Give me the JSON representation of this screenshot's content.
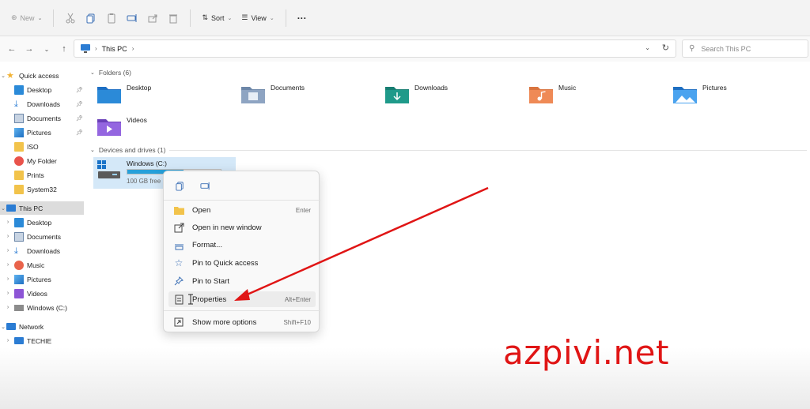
{
  "toolbar": {
    "new_label": "New",
    "sort_label": "Sort",
    "view_label": "View",
    "more_label": "···"
  },
  "address": {
    "path": "This PC",
    "search_placeholder": "Search This PC"
  },
  "sidebar": {
    "items": [
      {
        "label": "Quick access",
        "icon": "star-icon"
      },
      {
        "label": "Desktop",
        "icon": "desktop-icon"
      },
      {
        "label": "Downloads",
        "icon": "download-icon"
      },
      {
        "label": "Documents",
        "icon": "documents-icon"
      },
      {
        "label": "Pictures",
        "icon": "pictures-icon"
      },
      {
        "label": "ISO",
        "icon": "folder-icon"
      },
      {
        "label": "My Folder",
        "icon": "folder-icon"
      },
      {
        "label": "Prints",
        "icon": "folder-icon"
      },
      {
        "label": "System32",
        "icon": "folder-icon"
      },
      {
        "label": "This PC",
        "icon": "computer-icon"
      },
      {
        "label": "Desktop",
        "icon": "desktop-icon"
      },
      {
        "label": "Documents",
        "icon": "documents-icon"
      },
      {
        "label": "Downloads",
        "icon": "download-icon"
      },
      {
        "label": "Music",
        "icon": "music-icon"
      },
      {
        "label": "Pictures",
        "icon": "pictures-icon"
      },
      {
        "label": "Videos",
        "icon": "videos-icon"
      },
      {
        "label": "Windows (C:)",
        "icon": "drive-icon"
      },
      {
        "label": "Network",
        "icon": "network-icon"
      },
      {
        "label": "TECHIE",
        "icon": "computer-icon"
      }
    ]
  },
  "main": {
    "folders_title": "Folders (6)",
    "folders": [
      {
        "label": "Desktop"
      },
      {
        "label": "Documents"
      },
      {
        "label": "Downloads"
      },
      {
        "label": "Music"
      },
      {
        "label": "Pictures"
      },
      {
        "label": "Videos"
      }
    ],
    "devices_title": "Devices and drives (1)",
    "drive": {
      "name": "Windows (C:)",
      "free": "100 GB free",
      "used_fraction": 0.6
    }
  },
  "context_menu": {
    "items": [
      {
        "label": "Open",
        "shortcut": "Enter"
      },
      {
        "label": "Open in new window",
        "shortcut": ""
      },
      {
        "label": "Format...",
        "shortcut": ""
      },
      {
        "label": "Pin to Quick access",
        "shortcut": ""
      },
      {
        "label": "Pin to Start",
        "shortcut": ""
      },
      {
        "label": "Properties",
        "shortcut": "Alt+Enter"
      },
      {
        "label": "Show more options",
        "shortcut": "Shift+F10"
      }
    ]
  },
  "watermark": "azpivi.net",
  "colors": {
    "accent": "#26a0da",
    "arrow": "#e01515",
    "folder_yellow": "#f2c34b",
    "selected_bg": "#dcdcdc"
  }
}
